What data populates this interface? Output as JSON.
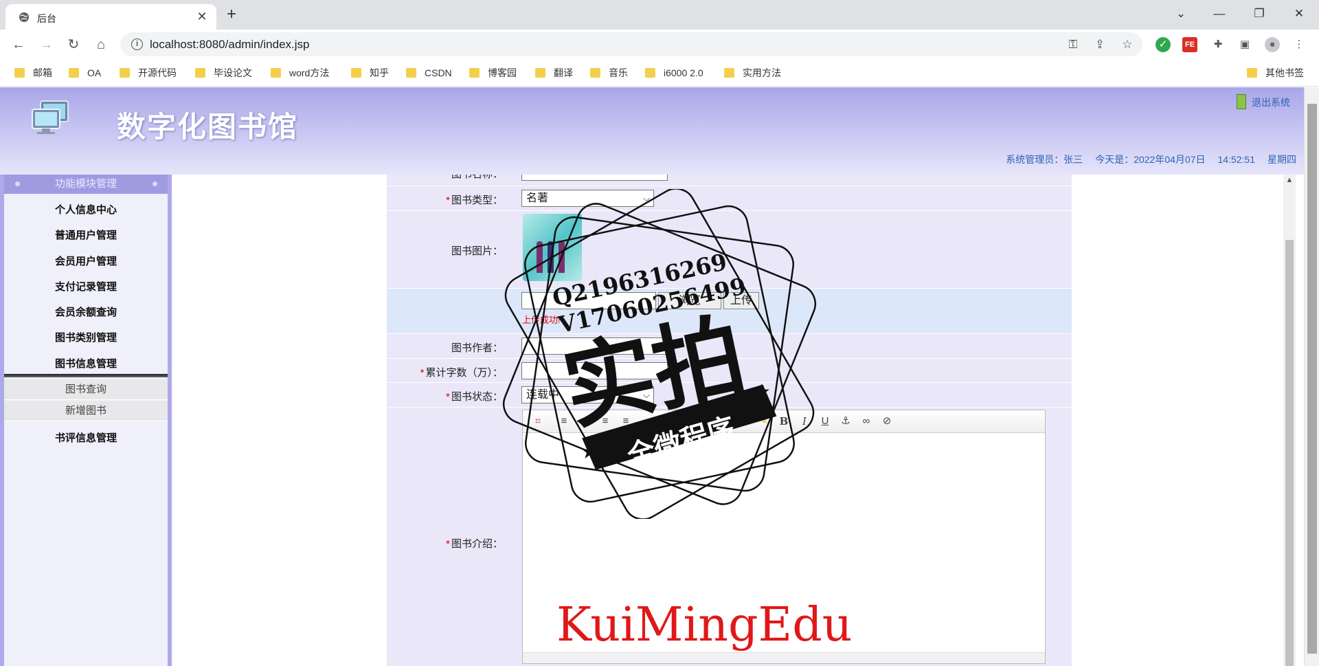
{
  "browser": {
    "tab_title": "后台",
    "new_tab": "+",
    "url": "localhost:8080/admin/index.jsp",
    "bookmarks": [
      "邮箱",
      "OA",
      "开源代码",
      "毕设论文",
      "word方法",
      "知乎",
      "CSDN",
      "博客园",
      "翻译",
      "音乐",
      "i6000 2.0",
      "实用方法"
    ],
    "other_bookmarks": "其他书签"
  },
  "header": {
    "title": "数字化图书馆",
    "logout": "退出系统",
    "admin": "系统管理员：张三",
    "today": "今天是：2022年04月07日",
    "time": "14:52:51",
    "weekday": "星期四"
  },
  "sidebar": {
    "section": "功能模块管理",
    "items": [
      "个人信息中心",
      "普通用户管理",
      "会员用户管理",
      "支付记录管理",
      "会员余额查询",
      "图书类别管理",
      "图书信息管理"
    ],
    "sub_items": [
      "图书查询",
      "新增图书"
    ],
    "last_item": "书评信息管理"
  },
  "form": {
    "name_label_partial": "图书名称：",
    "type_label": "图书类型：",
    "type_value": "名著",
    "image_label": "图书图片：",
    "browse_button": "浏览",
    "upload_button": "上传",
    "upload_msg": "上传成功!",
    "author_label": "图书作者：",
    "words_label": "累计字数（万）：",
    "status_label": "图书状态：",
    "status_value": "连载中",
    "intro_label": "图书介绍："
  },
  "overlay": {
    "stamp_line1": "Q2196316269",
    "stamp_line2": "V17060256499",
    "stamp_big": "实拍",
    "stamp_ribbon": "全微程序",
    "watermark": "KuiMingEdu"
  },
  "colors": {
    "header_top": "#a9a6e8",
    "sidebar_bg": "#ada9ea",
    "form_bg": "#e9e7f8",
    "link_blue": "#2e63b5",
    "required_red": "#dd0000",
    "watermark_red": "#e01818"
  }
}
